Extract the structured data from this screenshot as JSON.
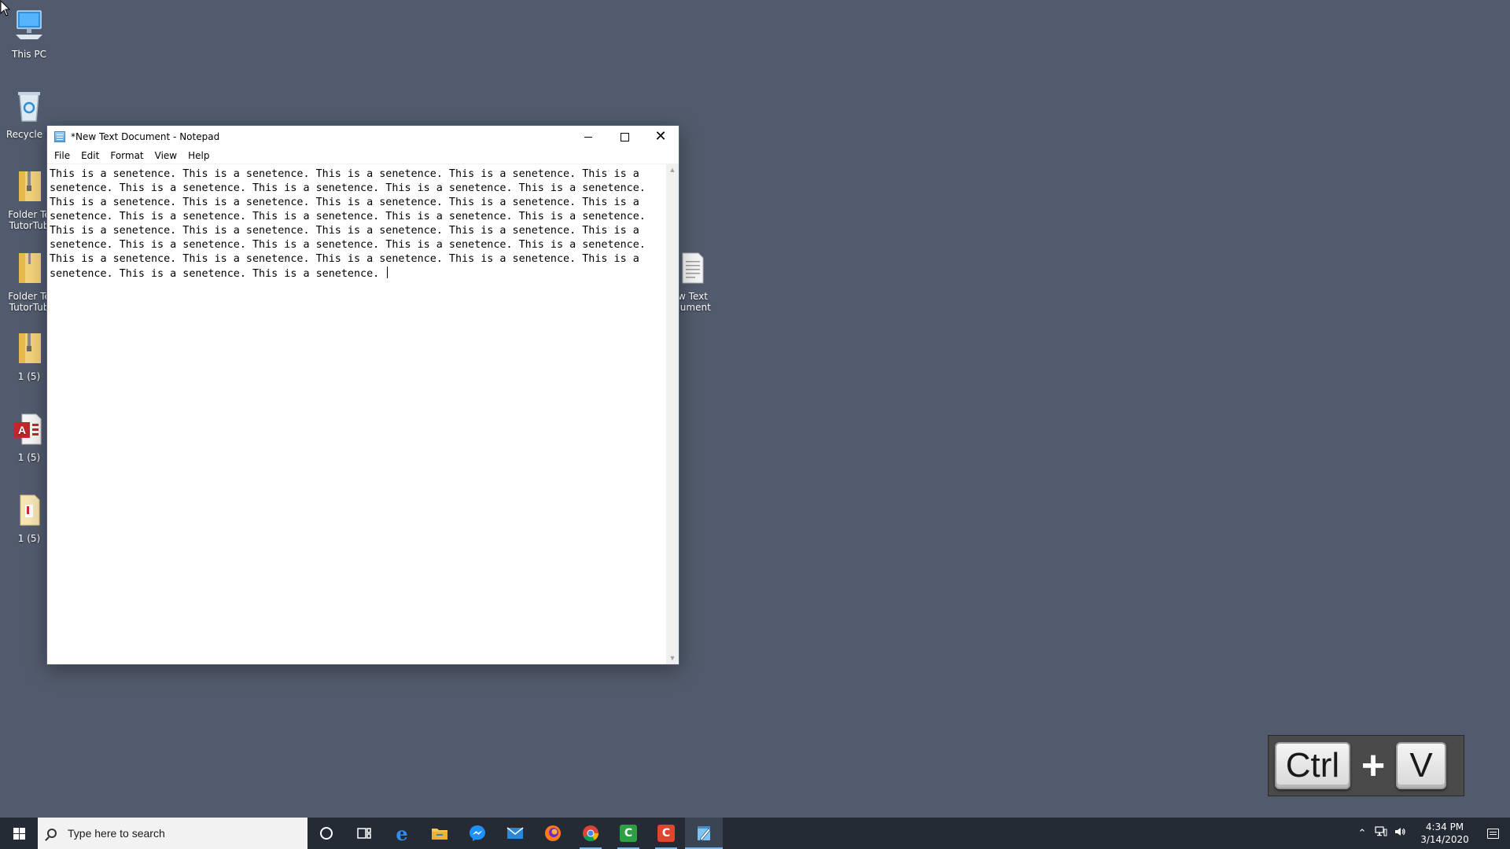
{
  "desktop": {
    "icons": [
      {
        "label": "This PC",
        "icon": "this-pc-icon"
      },
      {
        "label": "Recycle B",
        "icon": "recycle-bin-icon"
      },
      {
        "label": "Folder Te\nTutorTub",
        "icon": "zip-folder-icon"
      },
      {
        "label": "Folder Te\nTutorTub",
        "icon": "folder-icon"
      },
      {
        "label": "1 (5)",
        "icon": "zip-folder-icon"
      },
      {
        "label": "1 (5)",
        "icon": "access-database-icon"
      },
      {
        "label": "1 (5)",
        "icon": "pdf-file-icon"
      },
      {
        "label": "w Text\ncument",
        "icon": "text-document-icon"
      }
    ]
  },
  "notepad": {
    "title": "*New Text Document - Notepad",
    "menu": [
      "File",
      "Edit",
      "Format",
      "View",
      "Help"
    ],
    "lines": [
      "This is a senetence. This is a senetence. This is a senetence. This is a senetence. This is a",
      "senetence. This is a senetence. This is a senetence. This is a senetence. This is a senetence.",
      "This is a senetence. This is a senetence. This is a senetence. This is a senetence. This is a",
      "senetence. This is a senetence. This is a senetence. This is a senetence. This is a senetence.",
      "This is a senetence. This is a senetence. This is a senetence. This is a senetence. This is a",
      "senetence. This is a senetence. This is a senetence. This is a senetence. This is a senetence.",
      "This is a senetence. This is a senetence. This is a senetence. This is a senetence. This is a",
      "senetence. This is a senetence. This is a senetence. "
    ]
  },
  "key_overlay": {
    "key1": "Ctrl",
    "plus": "+",
    "key2": "V"
  },
  "taskbar": {
    "search_placeholder": "Type here to search",
    "apps": [
      {
        "name": "cortana",
        "icon": "cortana-icon",
        "running": false
      },
      {
        "name": "task-view",
        "icon": "task-view-icon",
        "running": false
      },
      {
        "name": "edge",
        "icon": "edge-icon",
        "running": false
      },
      {
        "name": "file-explorer",
        "icon": "file-explorer-icon",
        "running": false
      },
      {
        "name": "messenger",
        "icon": "messenger-icon",
        "running": false
      },
      {
        "name": "mail",
        "icon": "mail-icon",
        "running": false
      },
      {
        "name": "firefox",
        "icon": "firefox-icon",
        "running": false
      },
      {
        "name": "chrome",
        "icon": "chrome-icon",
        "running": true
      },
      {
        "name": "camtasia",
        "icon": "camtasia-icon",
        "running": true
      },
      {
        "name": "snagit",
        "icon": "snagit-icon",
        "running": true
      },
      {
        "name": "notepad",
        "icon": "notepad-icon",
        "running": true,
        "active": true
      }
    ],
    "clock": {
      "time": "4:34 PM",
      "date": "3/14/2020"
    }
  },
  "colors": {
    "desktop_bg": "#525b6d",
    "taskbar_bg": "#252b35",
    "accent": "#76b9ed",
    "window_border": "#2c6ab8"
  }
}
